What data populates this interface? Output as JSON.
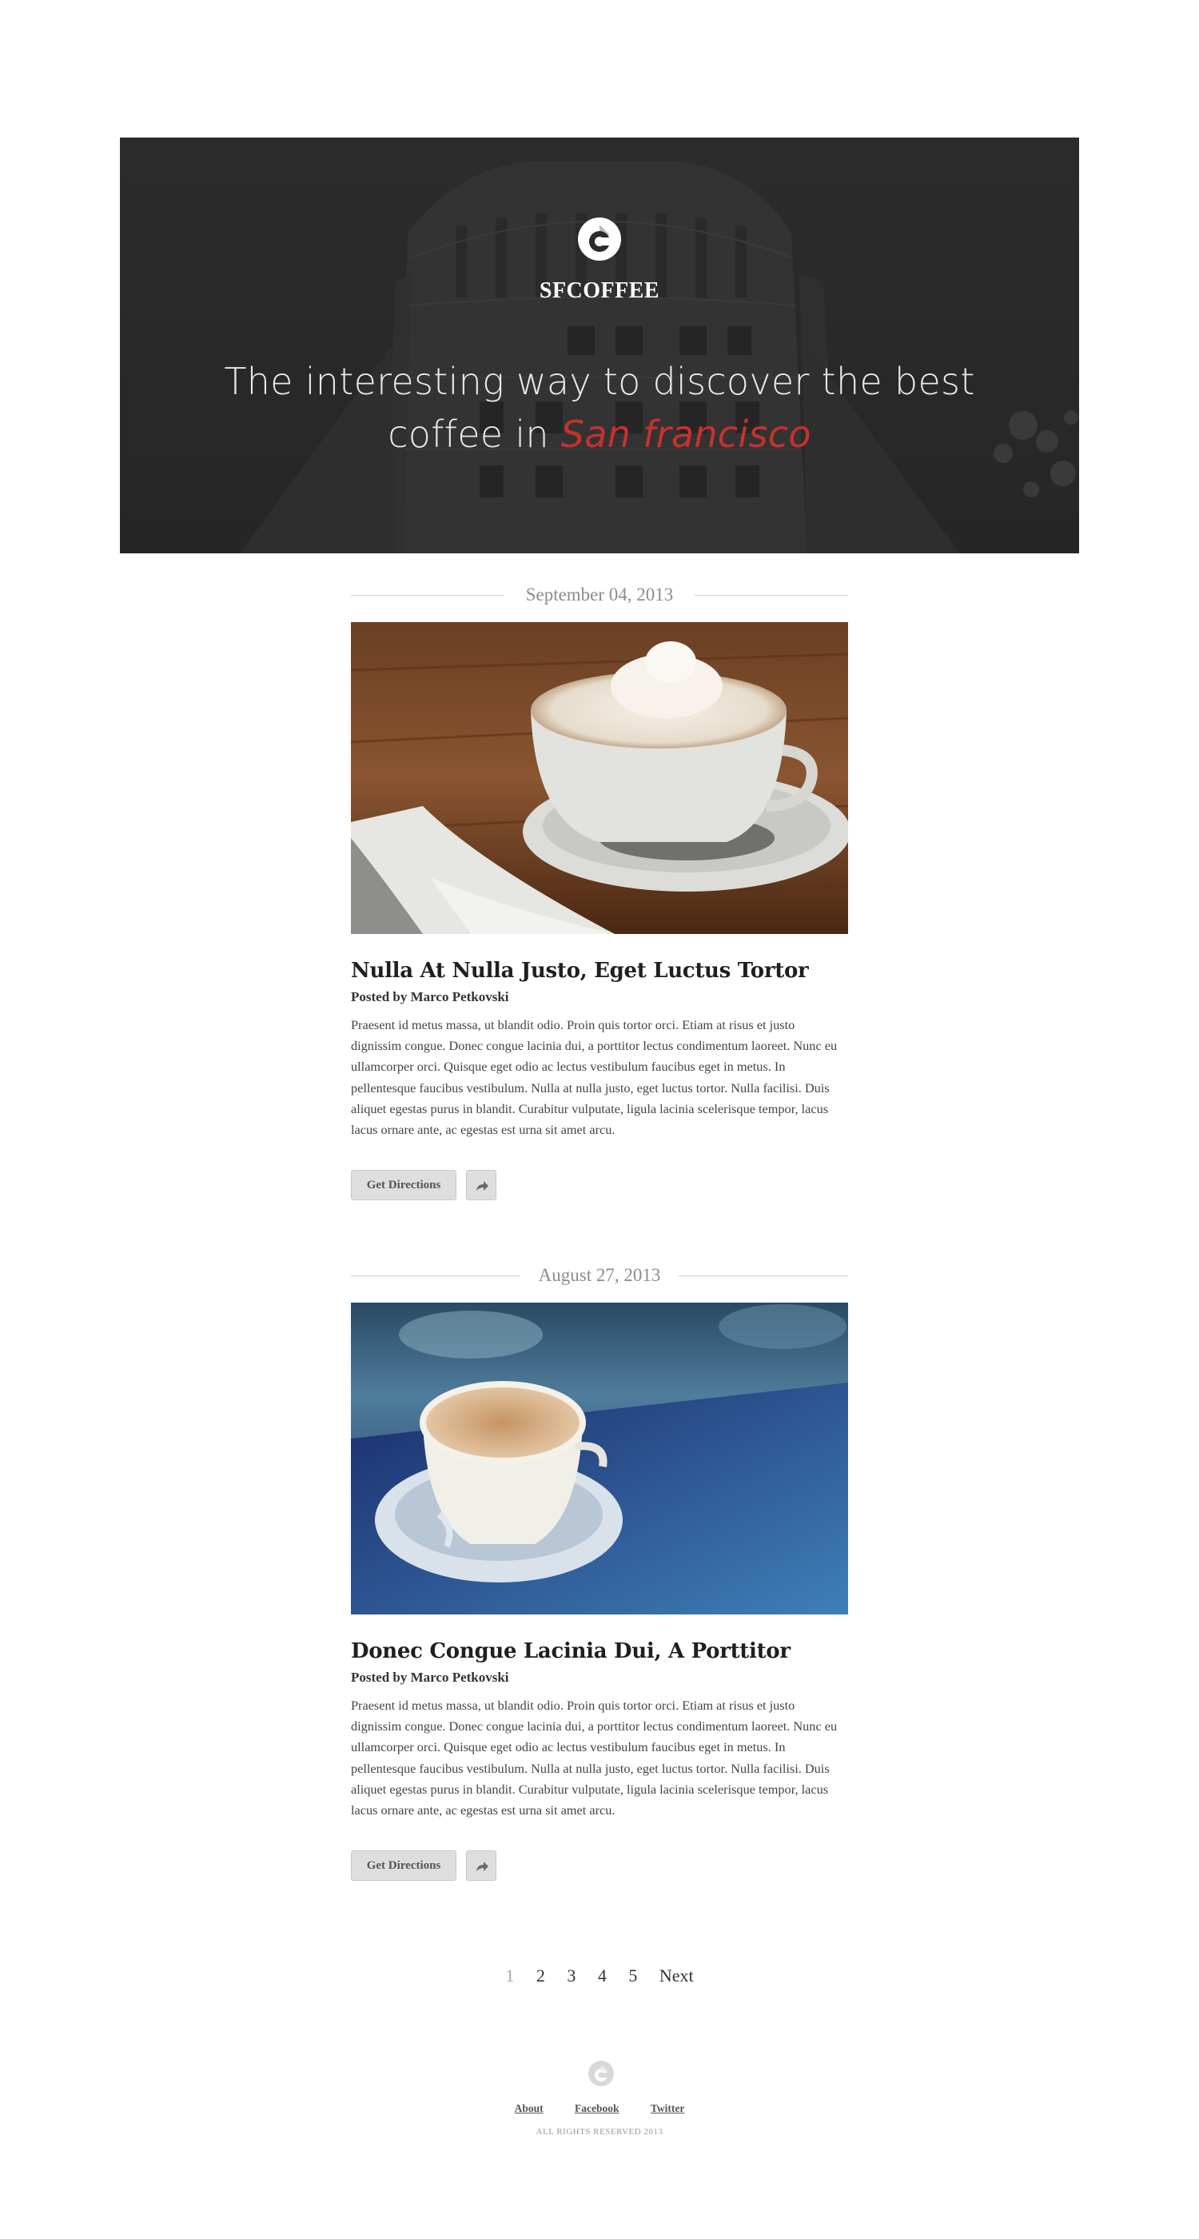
{
  "header": {
    "brand": "SFCOFFEE",
    "tagline_prefix": "The interesting way to discover the best coffee in ",
    "tagline_accent": "San francisco",
    "accent_color": "#c8312b"
  },
  "posts": [
    {
      "date": "September 04, 2013",
      "title": "Nulla At Nulla Justo, Eget Luctus Tortor",
      "author": "Posted by Marco Petkovski",
      "body": "Praesent id metus massa, ut blandit odio. Proin quis tortor orci. Etiam at risus et justo dignissim congue. Donec congue lacinia dui, a porttitor lectus condimentum laoreet. Nunc eu ullamcorper orci. Quisque eget odio ac lectus vestibulum faucibus eget in metus. In pellentesque faucibus vestibulum. Nulla at nulla justo, eget luctus tortor. Nulla facilisi. Duis aliquet egestas purus in blandit. Curabitur vulputate, ligula lacinia scelerisque tempor, lacus lacus ornare ante, ac egestas est urna sit amet arcu.",
      "directions_label": "Get Directions",
      "share_icon": "share-arrow-icon"
    },
    {
      "date": "August 27, 2013",
      "title": "Donec Congue Lacinia Dui, A Porttitor",
      "author": "Posted by Marco Petkovski",
      "body": "Praesent id metus massa, ut blandit odio. Proin quis tortor orci. Etiam at risus et justo dignissim congue. Donec congue lacinia dui, a porttitor lectus condimentum laoreet. Nunc eu ullamcorper orci. Quisque eget odio ac lectus vestibulum faucibus eget in metus. In pellentesque faucibus vestibulum. Nulla at nulla justo, eget luctus tortor. Nulla facilisi. Duis aliquet egestas purus in blandit. Curabitur vulputate, ligula lacinia scelerisque tempor, lacus lacus ornare ante, ac egestas est urna sit amet arcu.",
      "directions_label": "Get Directions",
      "share_icon": "share-arrow-icon"
    }
  ],
  "pagination": {
    "pages": [
      "1",
      "2",
      "3",
      "4",
      "5"
    ],
    "current": "1",
    "next_label": "Next"
  },
  "footer": {
    "links": [
      "About",
      "Facebook",
      "Twitter"
    ],
    "copyright": "ALL RIGHTS RESERVED 2013"
  }
}
